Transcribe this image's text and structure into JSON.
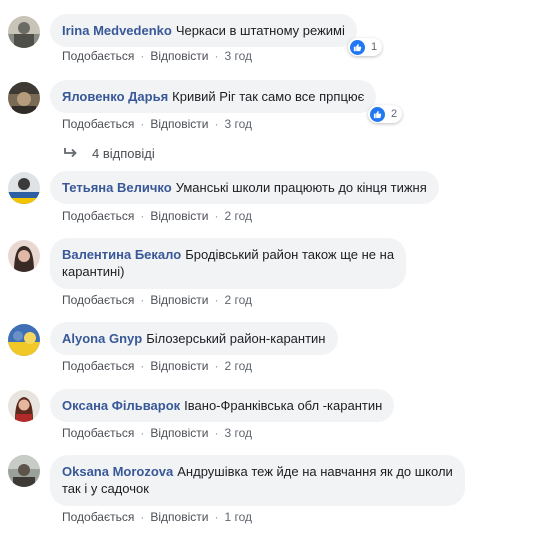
{
  "comments": [
    {
      "author": "Irina Medvedenko",
      "text": "Черкаси в штатному режимі",
      "like": "Подобається",
      "reply": "Відповісти",
      "time": "3 год",
      "reactions": "1"
    },
    {
      "author": "Яловенко Дарья",
      "text": "Кривий Ріг так само все прпцює",
      "like": "Подобається",
      "reply": "Відповісти",
      "time": "3 год",
      "reactions": "2"
    },
    {
      "author": "Тетьяна Величко",
      "text": "Уманські школи працюють до кінця тижня",
      "like": "Подобається",
      "reply": "Відповісти",
      "time": "2 год"
    },
    {
      "author": "Валентина Бекало",
      "text": "Бродівський район також ще не на",
      "text2": "карантині)",
      "like": "Подобається",
      "reply": "Відповісти",
      "time": "2 год"
    },
    {
      "author": "Alyona Gnyp",
      "text": "Білозерський район-карантин",
      "like": "Подобається",
      "reply": "Відповісти",
      "time": "2 год"
    },
    {
      "author": "Оксана Фільварок",
      "text": "Івано-Франківська обл -карантин",
      "like": "Подобається",
      "reply": "Відповісти",
      "time": "3 год"
    },
    {
      "author": "Oksana Morozova",
      "text": "Андрушівка теж йде на навчання як до школи",
      "text2": "так і у садочок",
      "like": "Подобається",
      "reply": "Відповісти",
      "time": "1 год"
    }
  ],
  "replies_link": "4 відповіді",
  "icons": {
    "like": "like-icon",
    "replies_arrow": "reply-arrow-icon"
  },
  "colors": {
    "author": "#385898",
    "bubble": "#f2f3f5",
    "like": "#2078f4"
  }
}
